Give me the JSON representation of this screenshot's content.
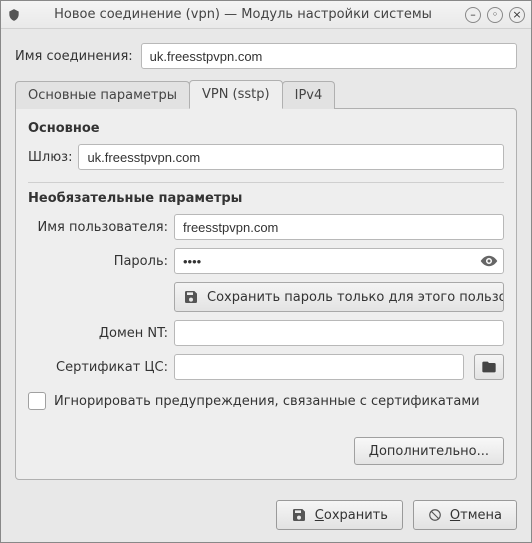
{
  "window": {
    "title": "Новое соединение (vpn) — Модуль настройки системы"
  },
  "connection": {
    "name_label": "Имя соединения:",
    "name_value": "uk.freesstpvpn.com"
  },
  "tabs": {
    "basic": "Основные параметры",
    "vpn": "VPN (sstp)",
    "ipv4": "IPv4"
  },
  "sections": {
    "main": "Основное",
    "optional": "Необязательные параметры"
  },
  "fields": {
    "gateway_label": "Шлюз:",
    "gateway_value": "uk.freesstpvpn.com",
    "username_label": "Имя пользователя:",
    "username_value": "freesstpvpn.com",
    "password_label": "Пароль:",
    "password_value": "••••",
    "password_scope": "Сохранить пароль только для этого пользователя (зашифровано)",
    "ntdomain_label": "Домен NT:",
    "ntdomain_value": "",
    "cacert_label": "Сертификат ЦС:",
    "cacert_value": "",
    "ignore_cert_label": "Игнорировать предупреждения, связанные с сертификатами",
    "advanced_label": "Дополнительно..."
  },
  "footer": {
    "save_prefix": "С",
    "save_rest": "охранить",
    "cancel_prefix": "О",
    "cancel_rest": "тмена"
  }
}
